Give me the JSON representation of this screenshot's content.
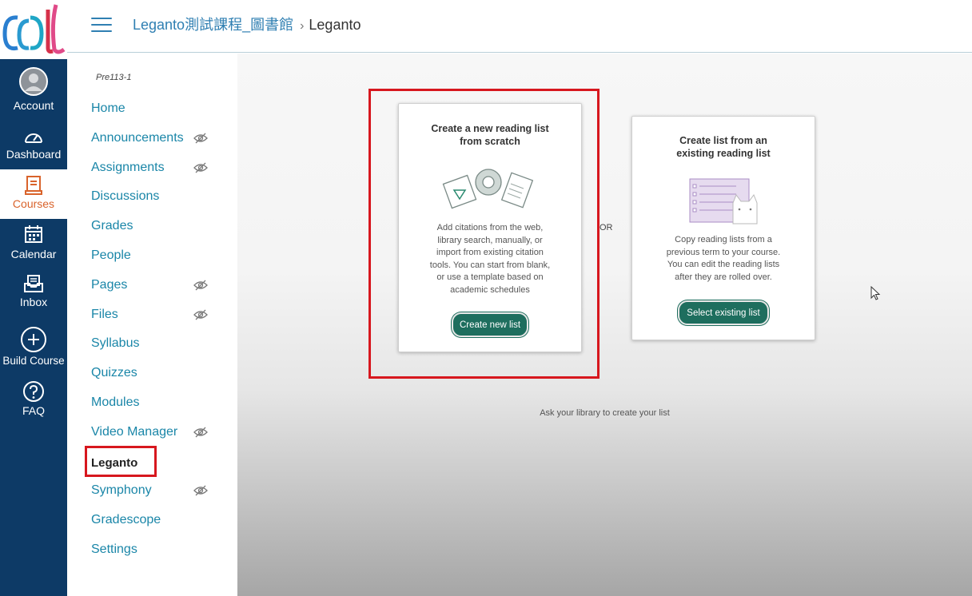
{
  "global_nav": {
    "items": [
      {
        "label": "Account",
        "icon": "avatar-icon"
      },
      {
        "label": "Dashboard",
        "icon": "dashboard-icon"
      },
      {
        "label": "Courses",
        "icon": "courses-icon",
        "active": true
      },
      {
        "label": "Calendar",
        "icon": "calendar-icon"
      },
      {
        "label": "Inbox",
        "icon": "inbox-icon"
      },
      {
        "label": "Build Course",
        "icon": "plus-circle-icon"
      },
      {
        "label": "FAQ",
        "icon": "help-icon"
      }
    ]
  },
  "header": {
    "breadcrumb": [
      "Leganto測試課程_圖書館",
      "Leganto"
    ]
  },
  "course_nav": {
    "term": "Pre113-1",
    "items": [
      {
        "label": "Home",
        "hidden": false
      },
      {
        "label": "Announcements",
        "hidden": true
      },
      {
        "label": "Assignments",
        "hidden": true
      },
      {
        "label": "Discussions",
        "hidden": false
      },
      {
        "label": "Grades",
        "hidden": false
      },
      {
        "label": "People",
        "hidden": false
      },
      {
        "label": "Pages",
        "hidden": true
      },
      {
        "label": "Files",
        "hidden": true
      },
      {
        "label": "Syllabus",
        "hidden": false
      },
      {
        "label": "Quizzes",
        "hidden": false
      },
      {
        "label": "Modules",
        "hidden": false
      },
      {
        "label": "Video Manager",
        "hidden": true
      },
      {
        "label": "Leganto",
        "hidden": false,
        "active": true
      },
      {
        "label": "Symphony",
        "hidden": true
      },
      {
        "label": "Gradescope",
        "hidden": false
      },
      {
        "label": "Settings",
        "hidden": false
      }
    ]
  },
  "main": {
    "new_card": {
      "title": [
        "Create a new reading list",
        "from scratch"
      ],
      "description": [
        "Add citations from the web,",
        "library search, manually, or",
        "import from existing citation",
        "tools. You can start from blank,",
        "or use a template based on",
        "academic schedules"
      ],
      "button": "Create new list"
    },
    "or_label": "OR",
    "existing_card": {
      "title": [
        "Create list from an",
        "existing reading list"
      ],
      "description": [
        "Copy reading lists from a",
        "previous term to your course.",
        "You can edit the reading lists",
        "after they are rolled over."
      ],
      "button": "Select existing list"
    },
    "ask_link": "Ask your library to create your list"
  },
  "colors": {
    "nav_bg": "#0d3a66",
    "link": "#1a86a8",
    "active_course": "#d9632b",
    "button": "#1e6e5e",
    "highlight": "#d7171e"
  }
}
